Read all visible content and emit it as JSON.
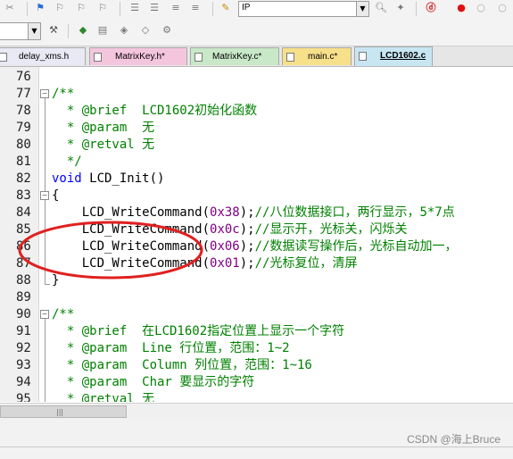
{
  "toolbar": {
    "target_value": "IP",
    "icons": [
      "scissors-icon",
      "flag-icon",
      "bookmark-prev-icon",
      "bookmark-next-icon",
      "bookmark-clear-icon",
      "indent-icon",
      "outdent-icon",
      "comment-icon",
      "uncomment-icon",
      "find-icon",
      "debug-icon",
      "breakpoint-icon",
      "breakpoint-disable-icon"
    ]
  },
  "toolbar2": {
    "icons": [
      "wand-icon",
      "build-icon",
      "rebuild-icon",
      "diamond-icon",
      "download-icon",
      "options-icon"
    ]
  },
  "tabs": [
    {
      "label": "delay_xms.h"
    },
    {
      "label": "MatrixKey.h*"
    },
    {
      "label": "MatrixKey.c*"
    },
    {
      "label": "main.c*"
    },
    {
      "label": "LCD1602.c"
    }
  ],
  "code": {
    "line76": {
      "num": "76"
    },
    "line77": {
      "num": "77",
      "text": "/**"
    },
    "line78": {
      "num": "78",
      "text": "  * @brief  LCD1602初始化函数"
    },
    "line79": {
      "num": "79",
      "text": "  * @param  无"
    },
    "line80": {
      "num": "80",
      "text": "  * @retval 无"
    },
    "line81": {
      "num": "81",
      "text": "  */"
    },
    "line82": {
      "num": "82",
      "kw": "void",
      "text": " LCD_Init()"
    },
    "line83": {
      "num": "83",
      "text": "{"
    },
    "line84": {
      "num": "84",
      "fn": "    LCD_WriteCommand(",
      "n": "0x38",
      "rest": ");",
      "cmt": "//八位数据接口，两行显示，5*7点"
    },
    "line85": {
      "num": "85",
      "fn": "    LCD_WriteCommand(",
      "n": "0x0c",
      "rest": ");",
      "cmt": "//显示开，光标关，闪烁关"
    },
    "line86": {
      "num": "86",
      "fn": "    LCD_WriteCommand(",
      "n": "0x06",
      "rest": ");",
      "cmt": "//数据读写操作后，光标自动加一，"
    },
    "line87": {
      "num": "87",
      "fn": "    LCD_WriteCommand(",
      "n": "0x01",
      "rest": ");",
      "cmt": "//光标复位，清屏"
    },
    "line88": {
      "num": "88",
      "text": "}"
    },
    "line89": {
      "num": "89"
    },
    "line90": {
      "num": "90",
      "text": "/**"
    },
    "line91": {
      "num": "91",
      "text": "  * @brief  在LCD1602指定位置上显示一个字符"
    },
    "line92": {
      "num": "92",
      "text": "  * @param  Line 行位置，范围：1~2"
    },
    "line93": {
      "num": "93",
      "text": "  * @param  Column 列位置，范围：1~16"
    },
    "line94": {
      "num": "94",
      "text": "  * @param  Char 要显示的字符"
    },
    "line95": {
      "num": "95",
      "text": "  * @retval 无"
    }
  },
  "watermark": "CSDN @海上Bruce",
  "colors": {
    "comment": "#008000",
    "keyword": "#0000ff",
    "number": "#800080",
    "annotation": "#e02020"
  }
}
